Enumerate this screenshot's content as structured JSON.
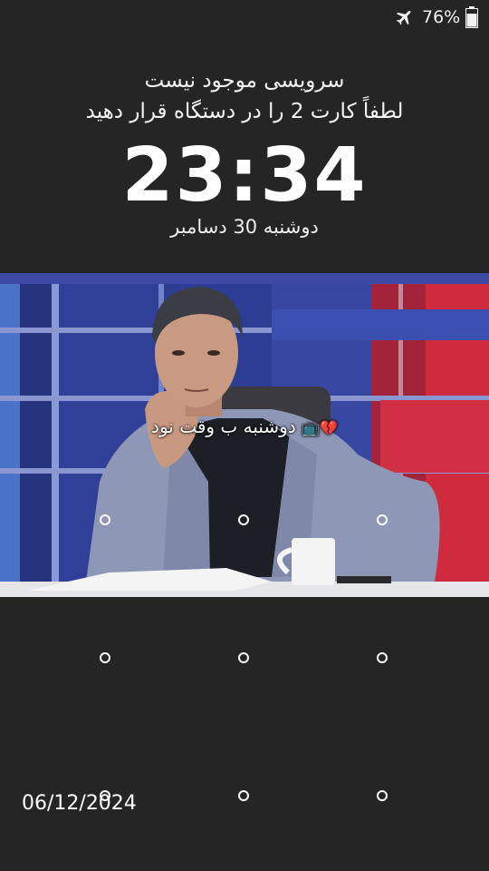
{
  "status_bar": {
    "battery_percent": "76%",
    "battery_level": 0.76,
    "icons": [
      "airplane-mode-icon",
      "battery-icon"
    ]
  },
  "lock_screen": {
    "no_service": "سرویسی موجود نیست",
    "insert_card": "لطفاً کارت 2 را در دستگاه قرار دهید",
    "time": "23:34",
    "date": "دوشنبه 30 دسامبر",
    "owner_info": "دوشنبه ب وقت نود",
    "owner_info_emoji": "📺💔",
    "footer_date": "06/12/2024"
  },
  "pattern_lock": {
    "rows": 3,
    "cols": 3
  }
}
